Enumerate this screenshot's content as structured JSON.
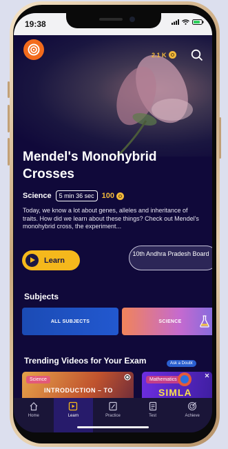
{
  "status_bar": {
    "time": "19:38"
  },
  "header": {
    "coins": "2.1 K"
  },
  "video": {
    "title": "Mendel's Monohybrid Crosses",
    "subject": "Science",
    "duration": "5 min 36 sec",
    "points": "100",
    "description": "Today, we know a lot about genes, alleles and inheritance of traits. How did we learn about these things? Check out Mendel's monohybrid cross, the experiment...",
    "learn_label": "Learn",
    "board_label": "10th Andhra Pradesh Board"
  },
  "subjects": {
    "heading": "Subjects",
    "cards": [
      {
        "label": "ALL SUBJECTS"
      },
      {
        "label": "SCIENCE"
      }
    ]
  },
  "trending": {
    "heading": "Trending Videos for Your Exam",
    "ask_doubt": "Ask a Doubt",
    "videos": [
      {
        "tag": "Science",
        "text": "INTRODUCTION – TO"
      },
      {
        "tag": "Mathematics",
        "text": "SIMLA"
      }
    ]
  },
  "tabbar": {
    "items": [
      {
        "label": "Home",
        "icon": "home-icon"
      },
      {
        "label": "Learn",
        "icon": "play-square-icon",
        "active": true
      },
      {
        "label": "Practice",
        "icon": "pencil-icon"
      },
      {
        "label": "Test",
        "icon": "clipboard-icon"
      },
      {
        "label": "Achieve",
        "icon": "target-icon"
      }
    ]
  },
  "colors": {
    "background": "#10093a",
    "accent": "#f5b81c",
    "active_tab": "#271b6b"
  }
}
